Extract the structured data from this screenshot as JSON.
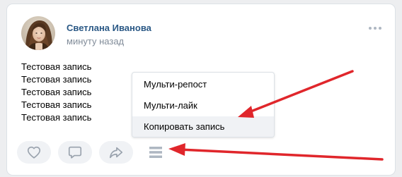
{
  "post": {
    "author_name": "Светлана Иванова",
    "time": "минуту назад",
    "lines": [
      "Тестовая запись",
      "Тестовая запись",
      "Тестовая запись",
      "Тестовая запись",
      "Тестовая запись"
    ]
  },
  "actions": {
    "like_icon": "heart-icon",
    "comment_icon": "comment-icon",
    "share_icon": "share-icon",
    "menu_icon": "hamburger-menu-icon"
  },
  "dropdown": {
    "items": [
      {
        "label": "Мульти-репост"
      },
      {
        "label": "Мульти-лайк"
      },
      {
        "label": "Копировать запись"
      }
    ],
    "hovered_index": 2
  },
  "colors": {
    "page_bg": "#edeef0",
    "author_link": "#2a5885",
    "secondary_text": "#818c99",
    "icon_gray": "#99a2ad",
    "button_bg": "#f0f2f5",
    "arrow_red": "#e0262b"
  }
}
